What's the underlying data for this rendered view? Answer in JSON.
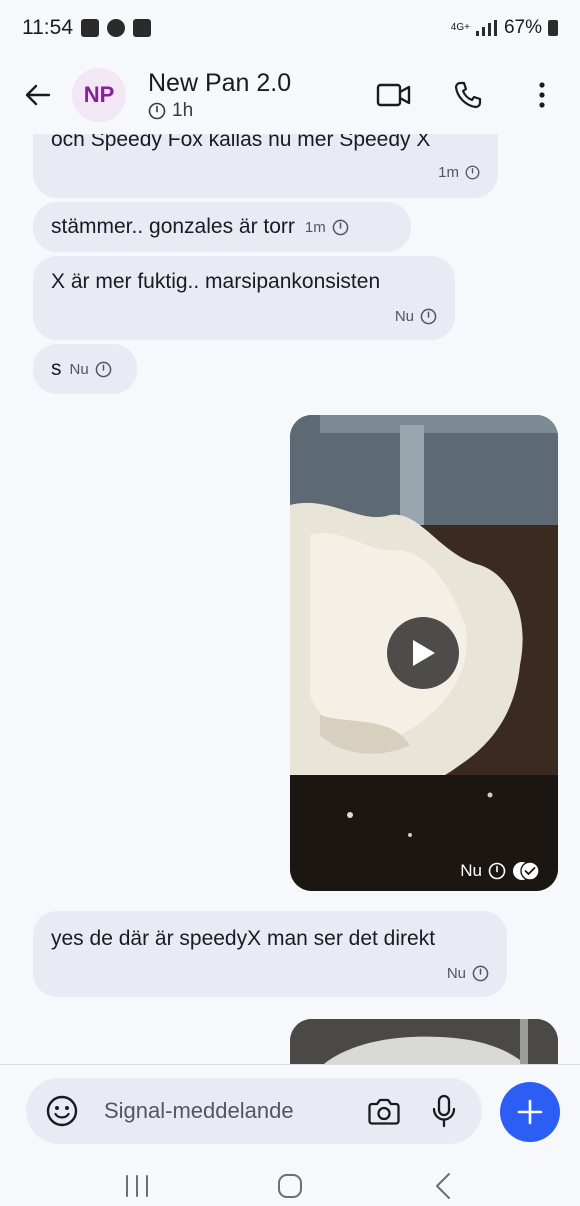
{
  "status_bar": {
    "time": "11:54",
    "network": "4G+",
    "battery": "67%"
  },
  "header": {
    "avatar_initials": "NP",
    "title": "New Pan 2.0",
    "timer": "1h"
  },
  "messages": [
    {
      "text": "och Speedy Fox kallas nu mer Speedy X",
      "time": "1m"
    },
    {
      "text": "stämmer.. gonzales är torr",
      "time": "1m"
    },
    {
      "text": "X är mer fuktig.. marsipankonsisten",
      "time": "Nu"
    },
    {
      "text": "s",
      "time": "Nu"
    },
    {
      "text": "yes de där är speedyX man ser det direkt",
      "time": "Nu"
    }
  ],
  "video_message": {
    "time": "Nu",
    "status": "read"
  },
  "composer": {
    "placeholder": "Signal-meddelande"
  },
  "colors": {
    "accent": "#2c5ef5",
    "bubble": "#e8ebf4",
    "avatar_bg": "#f3e6f5",
    "avatar_text": "#8b1e9b"
  },
  "icons": [
    "back-arrow-icon",
    "video-call-icon",
    "phone-icon",
    "more-icon",
    "timer-icon",
    "emoji-icon",
    "camera-icon",
    "mic-icon",
    "plus-icon",
    "play-icon"
  ]
}
